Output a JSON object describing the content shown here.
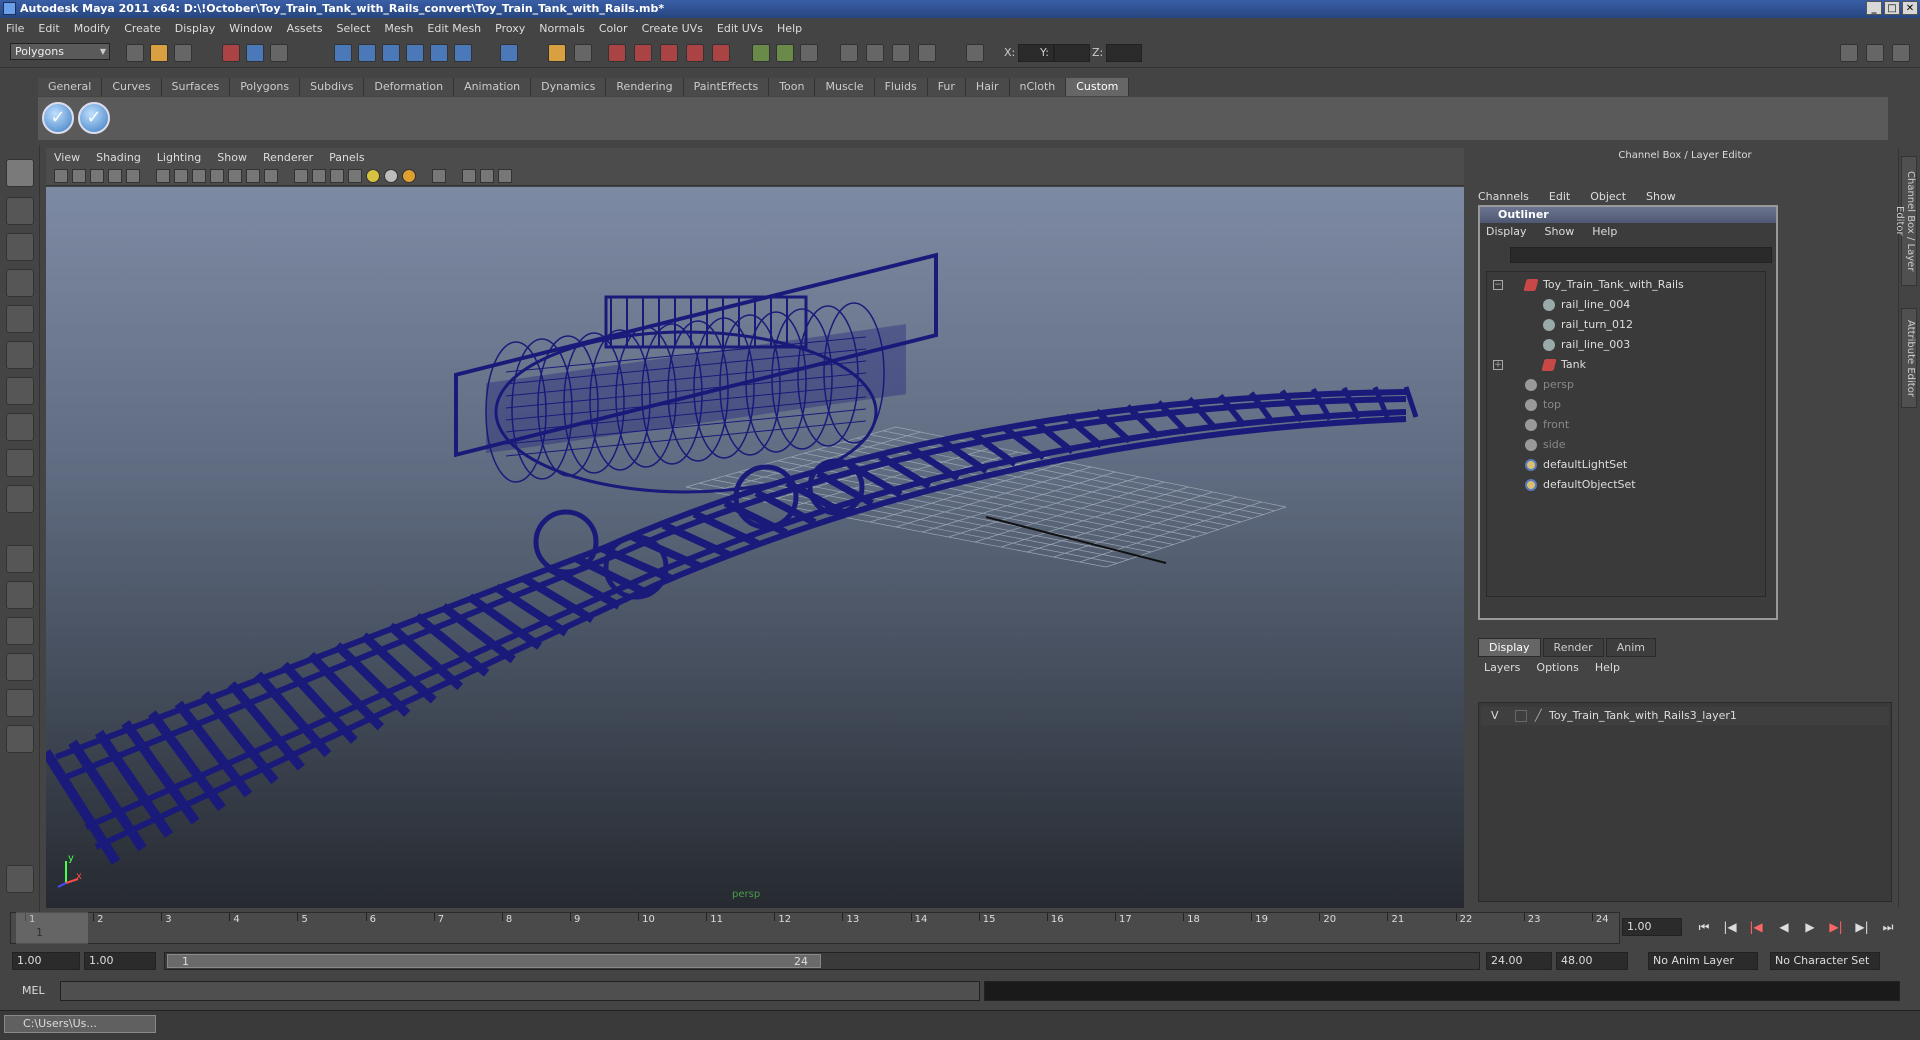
{
  "titlebar": {
    "title": "Autodesk Maya 2011 x64: D:\\!October\\Toy_Train_Tank_with_Rails_convert\\Toy_Train_Tank_with_Rails.mb*",
    "min": "_",
    "max": "□",
    "close": "✕"
  },
  "menubar": [
    "File",
    "Edit",
    "Modify",
    "Create",
    "Display",
    "Window",
    "Assets",
    "Select",
    "Mesh",
    "Edit Mesh",
    "Proxy",
    "Normals",
    "Color",
    "Create UVs",
    "Edit UVs",
    "Help"
  ],
  "statusline": {
    "mode": "Polygons",
    "x_label": "X:",
    "y_label": "Y:",
    "z_label": "Z:"
  },
  "shelf": {
    "tabs": [
      "General",
      "Curves",
      "Surfaces",
      "Polygons",
      "Subdivs",
      "Deformation",
      "Animation",
      "Dynamics",
      "Rendering",
      "PaintEffects",
      "Toon",
      "Muscle",
      "Fluids",
      "Fur",
      "Hair",
      "nCloth",
      "Custom"
    ],
    "active": "Custom",
    "button_glyph": "✓"
  },
  "viewport": {
    "menu": [
      "View",
      "Shading",
      "Lighting",
      "Show",
      "Renderer",
      "Panels"
    ],
    "camera": "persp",
    "axis_x": "x",
    "axis_y": "y"
  },
  "channel_box": {
    "title": "Channel Box / Layer Editor",
    "menu": [
      "Channels",
      "Edit",
      "Object",
      "Show"
    ]
  },
  "outliner": {
    "title": "Outliner",
    "menu": [
      "Display",
      "Show",
      "Help"
    ],
    "items": [
      {
        "label": "Toy_Train_Tank_with_Rails",
        "icon": "transform-icon",
        "indent": 0,
        "expander": "−"
      },
      {
        "label": "rail_line_004",
        "icon": "mesh-icon",
        "indent": 1
      },
      {
        "label": "rail_turn_012",
        "icon": "mesh-icon",
        "indent": 1
      },
      {
        "label": "rail_line_003",
        "icon": "mesh-icon",
        "indent": 1
      },
      {
        "label": "Tank",
        "icon": "transform-icon",
        "indent": 1,
        "expander": "+"
      },
      {
        "label": "persp",
        "icon": "camera-icon",
        "indent": 0,
        "dim": true
      },
      {
        "label": "top",
        "icon": "camera-icon",
        "indent": 0,
        "dim": true
      },
      {
        "label": "front",
        "icon": "camera-icon",
        "indent": 0,
        "dim": true
      },
      {
        "label": "side",
        "icon": "camera-icon",
        "indent": 0,
        "dim": true
      },
      {
        "label": "defaultLightSet",
        "icon": "set-icon",
        "indent": 0
      },
      {
        "label": "defaultObjectSet",
        "icon": "set-icon",
        "indent": 0
      }
    ]
  },
  "layers": {
    "tabs": [
      "Display",
      "Render",
      "Anim"
    ],
    "active": "Display",
    "menu": [
      "Layers",
      "Options",
      "Help"
    ],
    "row": {
      "visible": "V",
      "name": "Toy_Train_Tank_with_Rails3_layer1"
    }
  },
  "side_tabs": [
    "Channel Box / Layer Editor",
    "Attribute Editor"
  ],
  "timeline": {
    "ticks": [
      "1",
      "2",
      "3",
      "4",
      "5",
      "6",
      "7",
      "8",
      "9",
      "10",
      "11",
      "12",
      "13",
      "14",
      "15",
      "16",
      "17",
      "18",
      "19",
      "20",
      "21",
      "22",
      "23",
      "24"
    ],
    "current_marker": "1",
    "current_frame": "1.00"
  },
  "range": {
    "start_time": "1.00",
    "start_range": "1.00",
    "slider_start": "1",
    "slider_end": "24",
    "end_range": "24.00",
    "end_time": "48.00",
    "anim_layer": "No Anim Layer",
    "char_set": "No Character Set"
  },
  "mel": {
    "label": "MEL"
  },
  "taskbar": {
    "label": "C:\\Users\\Us..."
  },
  "colors": {
    "wire": "#1a1a7a",
    "grid": "#9aa4b4"
  }
}
